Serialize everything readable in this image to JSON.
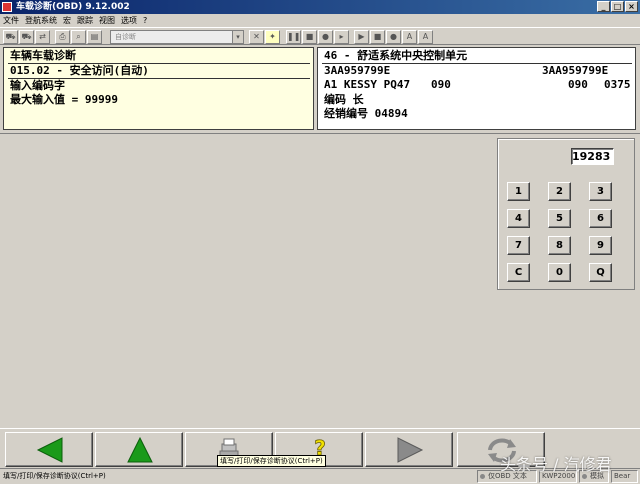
{
  "window": {
    "title": "车载诊断(OBD) 9.12.002",
    "minimize_label": "_",
    "maximize_label": "□",
    "close_label": "×"
  },
  "menu": {
    "items": [
      {
        "label": "文件"
      },
      {
        "label": "登航系统"
      },
      {
        "label": "宏"
      },
      {
        "label": "跟踪"
      },
      {
        "label": "视图"
      },
      {
        "label": "选项"
      },
      {
        "label": "?"
      }
    ]
  },
  "toolbar": {
    "combo_value": "自诊断",
    "combo_arrow": "▾"
  },
  "info_left": {
    "line1": "车辆车载诊断",
    "line2": "015.02 - 安全访问(自动)",
    "line3": "输入编码字",
    "line4": "最大输入值 = 99999"
  },
  "info_right": {
    "module": "46 - 舒适系统中央控制单元",
    "part_left": "3AA959799E",
    "part_right": "3AA959799E",
    "system_left": "A1 KESSY PQ47",
    "version_left": "090",
    "version_right": "090",
    "version_code": "0375",
    "coding": "编码 长",
    "dealer": "经销编号 04894"
  },
  "keypad": {
    "display_value": "19283",
    "keys": [
      "1",
      "2",
      "3",
      "4",
      "5",
      "6",
      "7",
      "8",
      "9",
      "C",
      "0",
      "Q"
    ]
  },
  "nav": {
    "tooltip": "填写/打印/保存诊断协议(Ctrl+P)",
    "colors": {
      "green": "#1a9a1a",
      "gray": "#8a8a8a",
      "yellow": "#f0e000"
    }
  },
  "status": {
    "text": "填写/打印/保存诊断协议(Ctrl+P)",
    "cell1": "仅OBD 文本",
    "cell2": "KWP2000",
    "cell3": "模拟",
    "cell4": "Bear"
  },
  "watermark": "头条号 / 汽修君"
}
